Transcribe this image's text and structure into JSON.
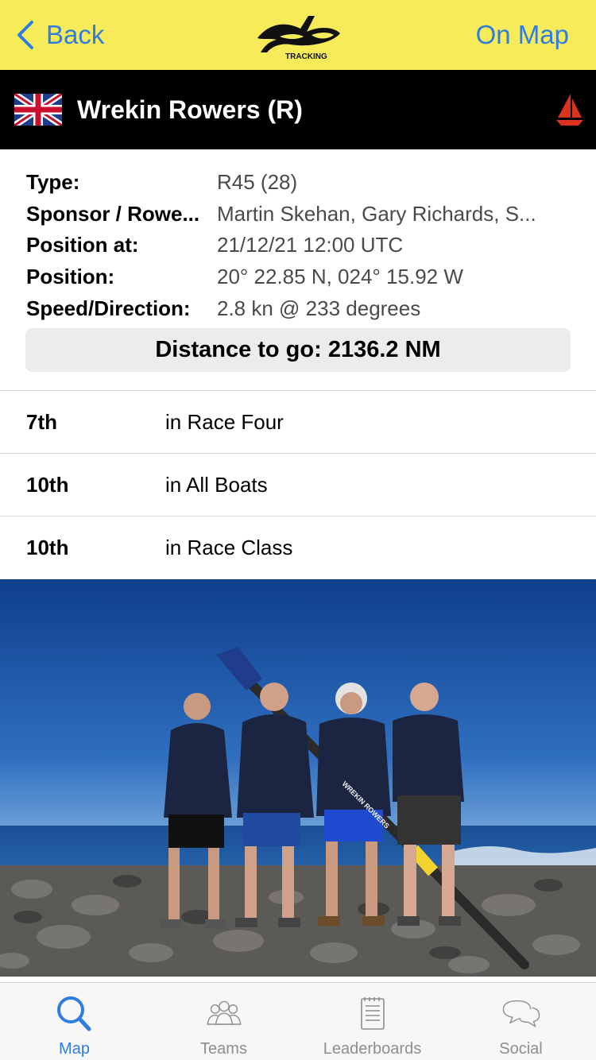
{
  "navbar": {
    "back_label": "Back",
    "on_map_label": "On Map",
    "logo_text": "TRACKING",
    "background_color": "#f7eb5a",
    "link_color": "#2f7de1"
  },
  "team": {
    "name": "Wrekin Rowers (R)",
    "flag": "uk-flag-icon",
    "boat_icon": "sailboat-icon"
  },
  "details": {
    "rows": [
      {
        "label": "Type:",
        "value": "R45 (28)"
      },
      {
        "label": "Sponsor / Rowe...",
        "value": "Martin Skehan, Gary Richards, S..."
      },
      {
        "label": "Position at:",
        "value": "21/12/21 12:00 UTC"
      },
      {
        "label": "Position:",
        "value": "20° 22.85 N, 024° 15.92 W"
      },
      {
        "label": "Speed/Direction:",
        "value": "2.8 kn @ 233 degrees"
      }
    ],
    "distance_to_go": "Distance to go: 2136.2 NM"
  },
  "rankings": [
    {
      "position": "7th",
      "description": "in Race Four"
    },
    {
      "position": "10th",
      "description": "in All Boats"
    },
    {
      "position": "10th",
      "description": "in Race Class"
    }
  ],
  "photo": {
    "oar_text": "WREKIN ROWERS"
  },
  "tabs": [
    {
      "label": "Map",
      "icon": "search-icon",
      "active": true
    },
    {
      "label": "Teams",
      "icon": "people-icon",
      "active": false
    },
    {
      "label": "Leaderboards",
      "icon": "document-icon",
      "active": false
    },
    {
      "label": "Social",
      "icon": "chat-bubbles-icon",
      "active": false
    }
  ]
}
